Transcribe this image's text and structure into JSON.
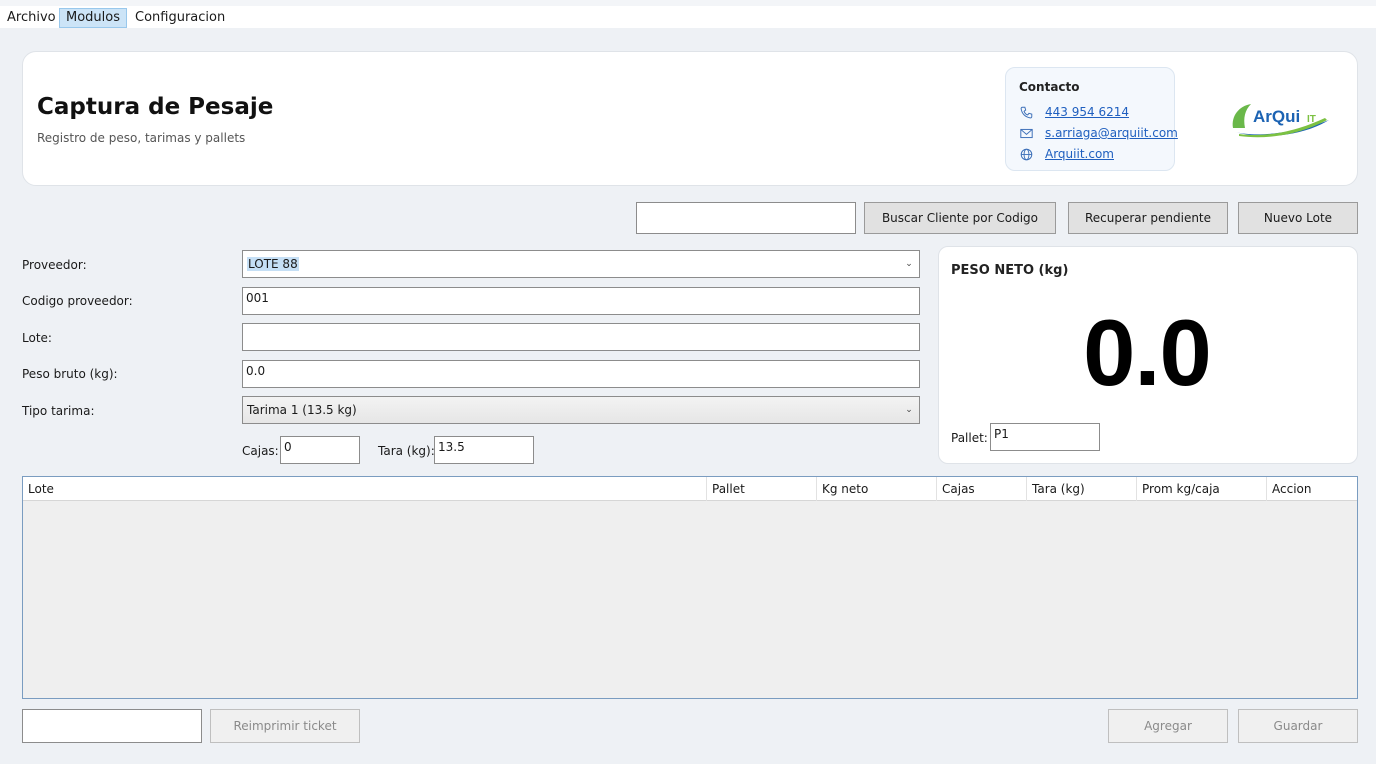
{
  "menu": {
    "items": [
      "Archivo",
      "Modulos",
      "Configuracion"
    ]
  },
  "header": {
    "title": "Captura de Pesaje",
    "subtitle": "Registro de peso, tarimas y pallets",
    "contact": {
      "title": "Contacto",
      "phone": "443 954 6214",
      "email": "s.arriaga@arquiit.com",
      "website": "Arquiit.com"
    },
    "logo_text": "ArQuiIT"
  },
  "search": {
    "input_value": "",
    "buscar_label": "Buscar Cliente por Codigo",
    "recuperar_label": "Recuperar pendiente",
    "nuevo_lote_label": "Nuevo Lote"
  },
  "form": {
    "proveedor": {
      "label": "Proveedor:",
      "value": "LOTE 88"
    },
    "codigo": {
      "label": "Codigo proveedor:",
      "value": "001"
    },
    "lote": {
      "label": "Lote:",
      "value": ""
    },
    "peso_bruto": {
      "label": "Peso bruto (kg):",
      "value": "0.0"
    },
    "tipo_tarima": {
      "label": "Tipo tarima:",
      "value": "Tarima 1 (13.5 kg)"
    },
    "cajas": {
      "label": "Cajas:",
      "value": "0"
    },
    "tara": {
      "label": "Tara (kg):",
      "value": "13.5"
    }
  },
  "peso_neto": {
    "title": "PESO NETO (kg)",
    "value": "0.0",
    "pallet_label": "Pallet:",
    "pallet_value": "P1"
  },
  "table": {
    "columns": [
      "Lote",
      "Pallet",
      "Kg neto",
      "Cajas",
      "Tara (kg)",
      "Prom kg/caja",
      "Accion"
    ],
    "rows": []
  },
  "footer": {
    "ticket_input_value": "",
    "reimprimir_label": "Reimprimir ticket",
    "agregar_label": "Agregar",
    "guardar_label": "Guardar"
  },
  "colors": {
    "accent": "#1f5fbf",
    "menu_active": "#cce4f7",
    "background": "#eef1f5"
  }
}
